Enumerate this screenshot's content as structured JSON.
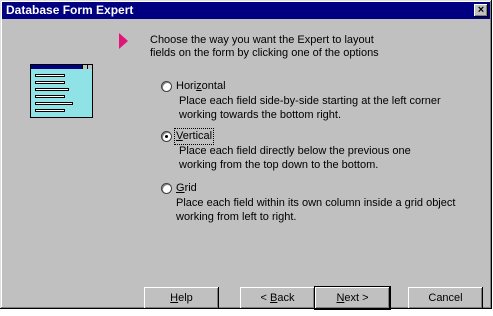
{
  "window": {
    "title": "Database Form Expert",
    "close_glyph": "×"
  },
  "intro": {
    "line1": "Choose the way you want the Expert to layout",
    "line2": "fields on the form by clicking one of the options"
  },
  "options": [
    {
      "label_acc": "",
      "label_pre": "Hori",
      "label_acc_char": "z",
      "label_post": "ontal",
      "desc1": "Place each field side-by-side starting at the left corner",
      "desc2": "working towards the bottom right.",
      "selected": false
    },
    {
      "label_pre": "",
      "label_acc_char": "V",
      "label_post": "ertical",
      "desc1": "Place each field directly below the previous one",
      "desc2": "working from the top down to the bottom.",
      "selected": true
    },
    {
      "label_pre": "",
      "label_acc_char": "G",
      "label_post": "rid",
      "desc1": "Place each field within its own column inside a grid object",
      "desc2": "working from left to right.",
      "selected": false
    }
  ],
  "buttons": {
    "help_acc": "H",
    "help_rest": "elp",
    "back_prefix": "< ",
    "back_acc": "B",
    "back_rest": "ack",
    "next_acc": "N",
    "next_rest": "ext >",
    "cancel": "Cancel"
  }
}
